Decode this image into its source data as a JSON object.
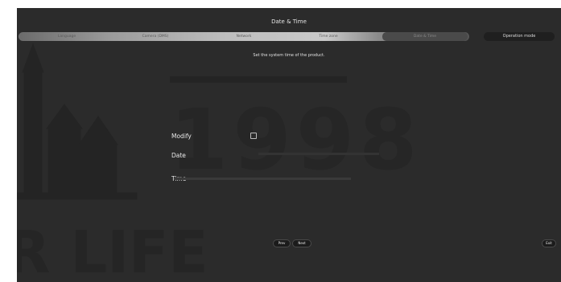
{
  "header": {
    "title": "Date & Time"
  },
  "steps": [
    {
      "label": "Language",
      "active": false
    },
    {
      "label": "Camera (DMS)",
      "active": false
    },
    {
      "label": "Network",
      "active": false
    },
    {
      "label": "Time zone",
      "active": false
    },
    {
      "label": "Date & Time",
      "active": true
    }
  ],
  "operation_mode_label": "Operation mode",
  "subtitle": "Set the system time of the product.",
  "background": {
    "year_text": "1998",
    "life_text": "R LIFE"
  },
  "form": {
    "modify_label": "Modify",
    "modify_checked": false,
    "date_label": "Date",
    "time_label": "Time"
  },
  "footer": {
    "prev_label": "Prev",
    "next_label": "Next",
    "exit_label": "Exit"
  },
  "colors": {
    "background": "#2b2b2b",
    "text": "#eaeaea",
    "border": "#ffffff"
  }
}
